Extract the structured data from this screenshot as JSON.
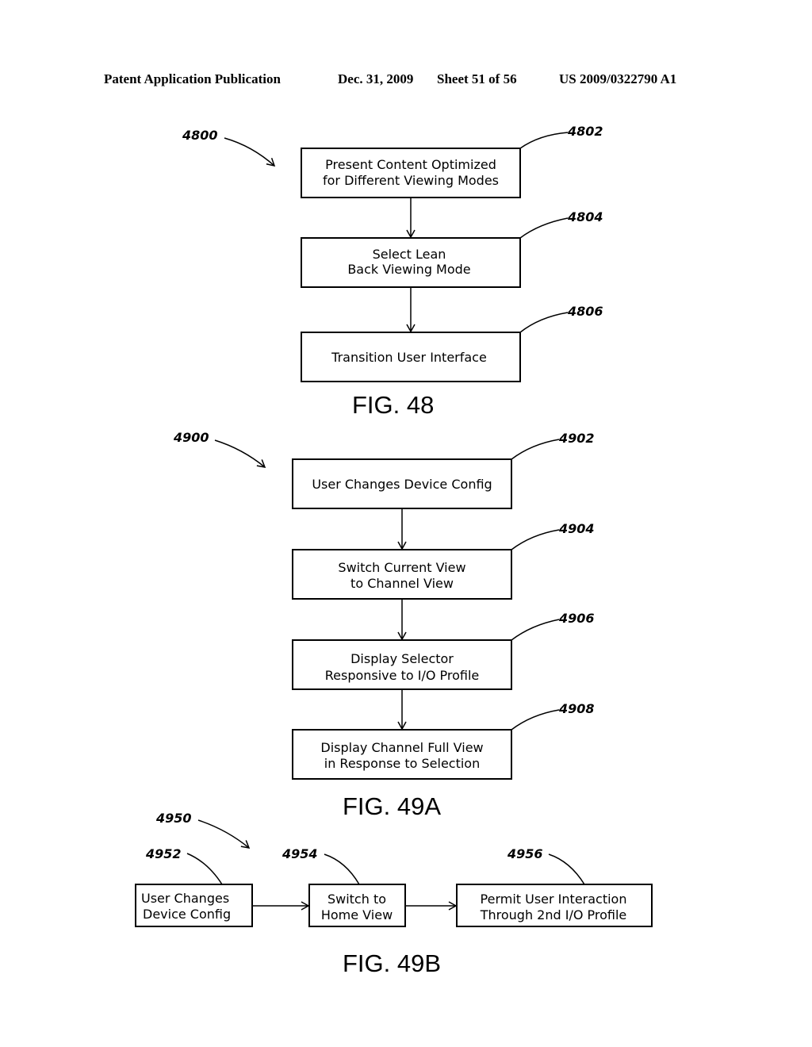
{
  "header": {
    "publication": "Patent Application Publication",
    "date": "Dec. 31, 2009",
    "sheet": "Sheet 51 of 56",
    "number": "US 2009/0322790 A1"
  },
  "fig48": {
    "ref": "4800",
    "caption": "FIG. 48",
    "steps": [
      {
        "ref": "4802",
        "lines": [
          "Present Content Optimized",
          "for Different Viewing Modes"
        ]
      },
      {
        "ref": "4804",
        "lines": [
          "Select Lean",
          "Back Viewing Mode"
        ]
      },
      {
        "ref": "4806",
        "lines": [
          "Transition User Interface"
        ]
      }
    ]
  },
  "fig49a": {
    "ref": "4900",
    "caption": "FIG. 49A",
    "steps": [
      {
        "ref": "4902",
        "lines": [
          "User Changes Device Config"
        ]
      },
      {
        "ref": "4904",
        "lines": [
          "Switch Current View",
          "to Channel View"
        ]
      },
      {
        "ref": "4906",
        "lines": [
          "Display Selector",
          "Responsive to I/O Profile"
        ]
      },
      {
        "ref": "4908",
        "lines": [
          "Display Channel Full View",
          "in Response to Selection"
        ]
      }
    ]
  },
  "fig49b": {
    "ref": "4950",
    "caption": "FIG. 49B",
    "steps": [
      {
        "ref": "4952",
        "lines": [
          "User Changes",
          "Device Config"
        ]
      },
      {
        "ref": "4954",
        "lines": [
          "Switch to",
          "Home View"
        ]
      },
      {
        "ref": "4956",
        "lines": [
          "Permit User Interaction",
          "Through 2nd I/O Profile"
        ]
      }
    ]
  }
}
